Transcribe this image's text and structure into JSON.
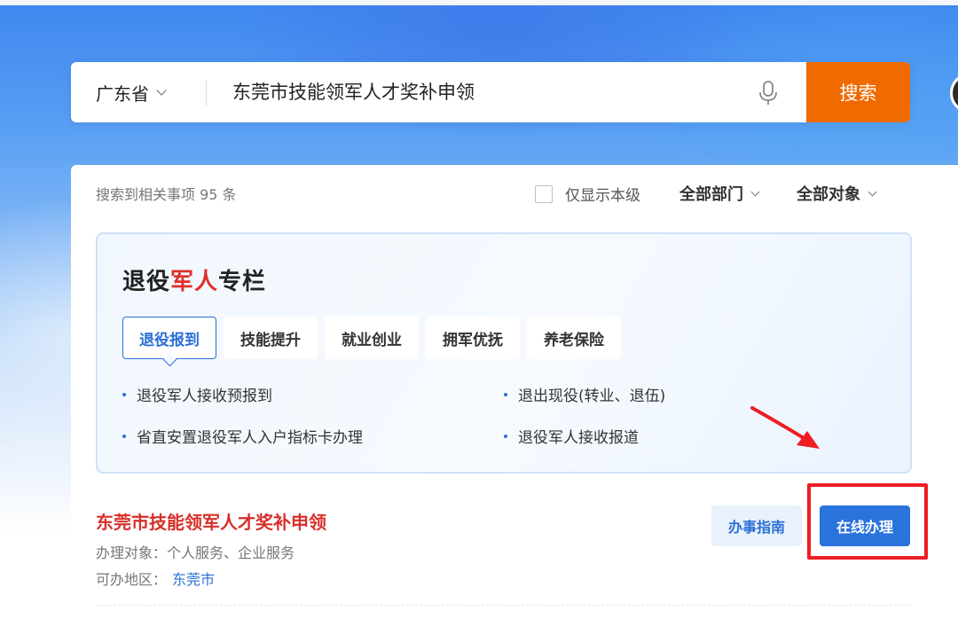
{
  "search": {
    "region_label": "广东省",
    "query": "东莞市技能领军人才奖补申领",
    "button_label": "搜索"
  },
  "filters": {
    "result_count_text": "搜索到相关事项 95 条",
    "only_this_level_label": "仅显示本级",
    "only_this_level_checked": false,
    "department_label": "全部部门",
    "target_label": "全部对象"
  },
  "veteran_panel": {
    "title_prefix": "退役",
    "title_highlight": "军人",
    "title_suffix": "专栏",
    "tabs": [
      {
        "label": "退役报到",
        "active": true
      },
      {
        "label": "技能提升",
        "active": false
      },
      {
        "label": "就业创业",
        "active": false
      },
      {
        "label": "拥军优抚",
        "active": false
      },
      {
        "label": "养老保险",
        "active": false
      }
    ],
    "links": [
      "退役军人接收预报到",
      "退出现役(转业、退伍)",
      "省直安置退役军人入户指标卡办理",
      "退役军人接收报道"
    ]
  },
  "result": {
    "title": "东莞市技能领军人才奖补申领",
    "target_line": "办理对象：个人服务、企业服务",
    "region_label": "可办地区：",
    "region_value": "东莞市",
    "guide_button": "办事指南",
    "online_button": "在线办理"
  },
  "colors": {
    "accent_blue": "#2a72dc",
    "search_orange": "#ef6a00",
    "title_red": "#d6302a",
    "annotation_red": "#ee1d24"
  },
  "icons": [
    "chevron-down-icon",
    "microphone-icon",
    "arrow-annotation"
  ]
}
